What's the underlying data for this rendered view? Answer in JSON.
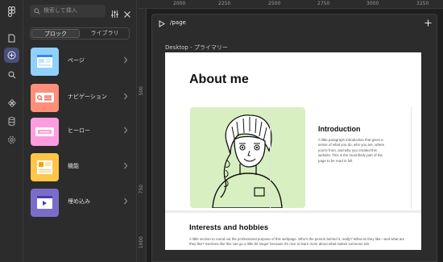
{
  "search": {
    "placeholder": "検索して挿入"
  },
  "tabs": {
    "blocks": "ブロック",
    "library": "ライブラリ"
  },
  "blocks": [
    {
      "label": "ページ",
      "color": "#8fd0ff"
    },
    {
      "label": "ナビゲーション",
      "color": "#ff8f7a"
    },
    {
      "label": "ヒーロー",
      "color": "#ff9ce0"
    },
    {
      "label": "機能",
      "color": "#ffc64a"
    },
    {
      "label": "埋め込み",
      "color": "#7a6dc9"
    }
  ],
  "ruler": {
    "top": [
      "2000",
      "2250",
      "2500",
      "2750",
      "3000",
      "3250"
    ],
    "left": [
      "500",
      "750",
      "1000"
    ]
  },
  "canvas": {
    "page_title": "/page",
    "frame_label": "Desktop - プライマリー"
  },
  "site": {
    "heading": "About me",
    "intro_title": "Introduction",
    "intro_text": "A little paragraph introduction that gives a sense of what you do, who you are, where you're from, and why you created this website. This is the most likely part of the page to be read in full.",
    "interests_title": "Interests and hobbies",
    "interests_text": "A little section to round out the professional purpose of this webpage. Who's the person behind it, really? What do they like—and what are they like? Sections like this can go a little bit longer because it's nice to learn more about what makes someone tick."
  },
  "colors": {
    "accent": "#4a4f7a",
    "hero_bg": "#d7efc1"
  }
}
